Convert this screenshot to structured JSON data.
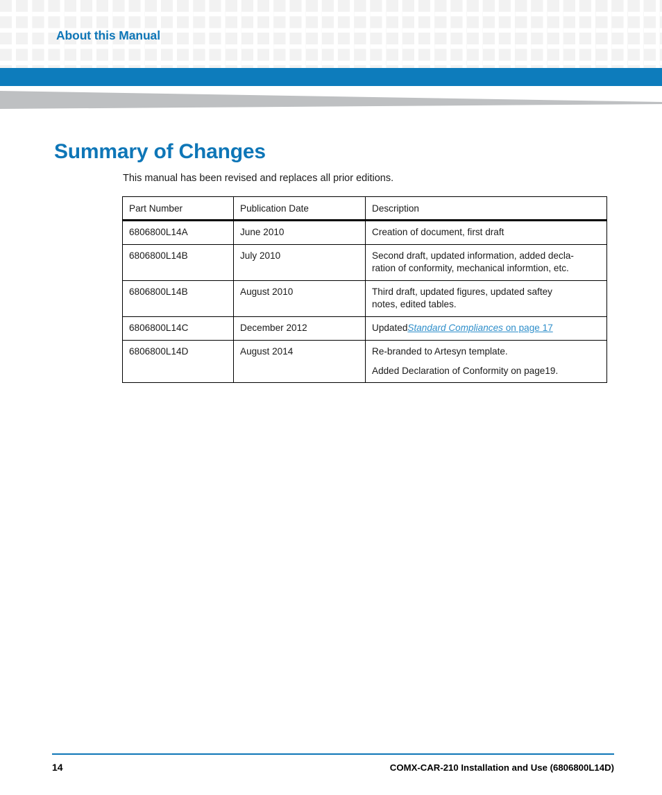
{
  "header": {
    "running_head": "About this Manual",
    "accent_color": "#0E76B7",
    "bar_color": "#0D7CBC",
    "wedge_color": "#BEC0C2",
    "checker_color": "#F2F2F2"
  },
  "main": {
    "title": "Summary of Changes",
    "intro": "This manual has been revised and replaces all prior editions."
  },
  "table": {
    "headers": {
      "part_number": "Part Number",
      "publication_date": "Publication Date",
      "description": "Description"
    },
    "rows": [
      {
        "part_number": "6806800L14A",
        "publication_date": "June 2010",
        "description_lines": [
          "Creation of document, first draft"
        ]
      },
      {
        "part_number": "6806800L14B",
        "publication_date": "July 2010",
        "description_lines": [
          "Second draft, updated information, added decla-",
          "ration of conformity, mechanical informtion, etc."
        ]
      },
      {
        "part_number": "6806800L14B",
        "publication_date": "August 2010",
        "description_lines": [
          "Third draft, updated figures, updated saftey",
          "notes, edited tables."
        ]
      },
      {
        "part_number": "6806800L14C",
        "publication_date": "December 2012",
        "description_prefix": "Updated",
        "description_link_italic": "Standard Compliances",
        "description_link_tail": " on page 17",
        "link_color": "#2E8ECA"
      },
      {
        "part_number": "6806800L14D",
        "publication_date": "August 2014",
        "description_lines": [
          "Re-branded to Artesyn template.",
          "Added Declaration of Conformity on page19."
        ]
      }
    ]
  },
  "footer": {
    "page_number": "14",
    "document_title": "COMX-CAR-210 Installation and Use (6806800L14D)",
    "rule_color": "#0E76B7"
  }
}
